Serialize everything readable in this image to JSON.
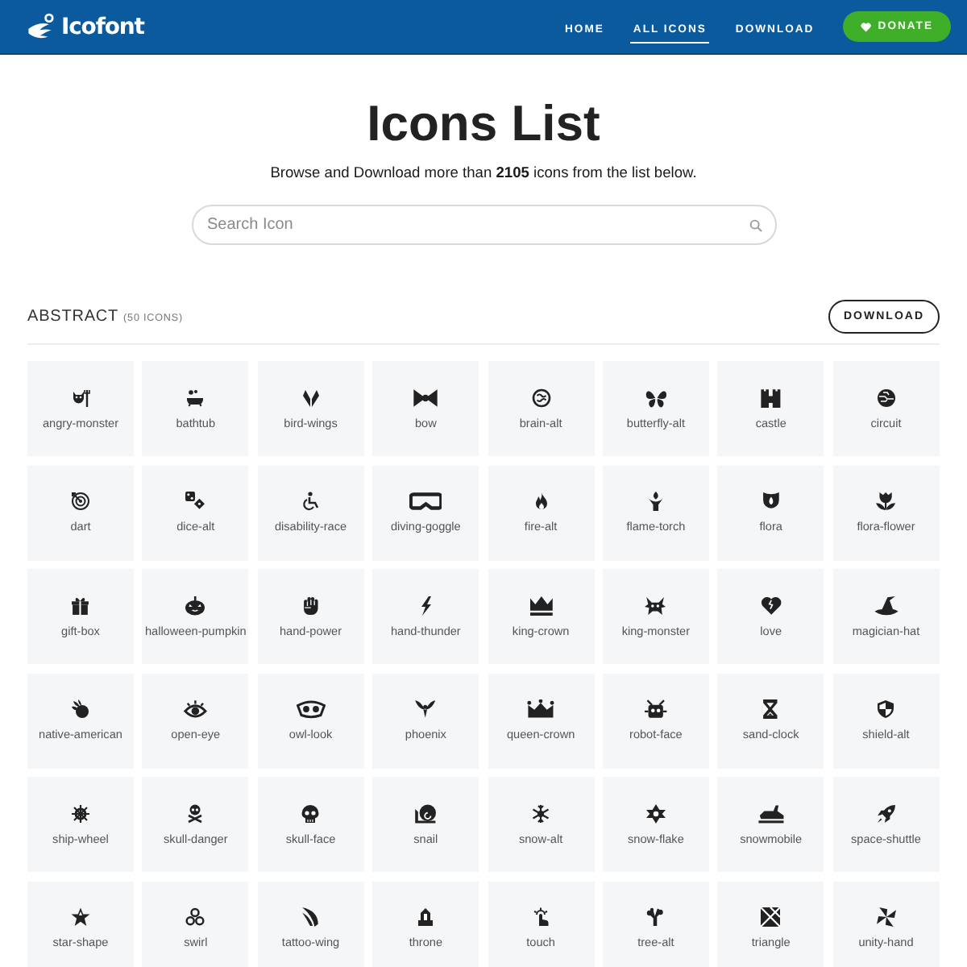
{
  "header": {
    "logo": {
      "text": "Icofont"
    },
    "nav": [
      {
        "label": "HOME",
        "selected": false
      },
      {
        "label": "ALL ICONS",
        "selected": true
      },
      {
        "label": "DOWNLOAD",
        "selected": false
      }
    ],
    "donate_button": {
      "label": "DONATE"
    }
  },
  "hero": {
    "title": "Icons List",
    "subtitle": "Browse and Download more than **2105** icons from the list below.",
    "search": {
      "placeholder": "Search Icon"
    }
  },
  "section": {
    "title": "ABSTRACT",
    "count": "(50 ICONS)",
    "download_button": {
      "label": "DOWNLOAD"
    },
    "icons": [
      {
        "label": "angry-monster"
      },
      {
        "label": "bathtub"
      },
      {
        "label": "bird-wings"
      },
      {
        "label": "bow"
      },
      {
        "label": "brain-alt"
      },
      {
        "label": "butterfly-alt"
      },
      {
        "label": "castle"
      },
      {
        "label": "circuit"
      },
      {
        "label": "dart"
      },
      {
        "label": "dice-alt"
      },
      {
        "label": "disability-race"
      },
      {
        "label": "diving-goggle"
      },
      {
        "label": "fire-alt"
      },
      {
        "label": "flame-torch"
      },
      {
        "label": "flora"
      },
      {
        "label": "flora-flower"
      },
      {
        "label": "gift-box"
      },
      {
        "label": "halloween-pumpkin"
      },
      {
        "label": "hand-power"
      },
      {
        "label": "hand-thunder"
      },
      {
        "label": "king-crown"
      },
      {
        "label": "king-monster"
      },
      {
        "label": "love"
      },
      {
        "label": "magician-hat"
      },
      {
        "label": "native-american"
      },
      {
        "label": "open-eye"
      },
      {
        "label": "owl-look"
      },
      {
        "label": "phoenix"
      },
      {
        "label": "queen-crown"
      },
      {
        "label": "robot-face"
      },
      {
        "label": "sand-clock"
      },
      {
        "label": "shield-alt"
      },
      {
        "label": "ship-wheel"
      },
      {
        "label": "skull-danger"
      },
      {
        "label": "skull-face"
      },
      {
        "label": "snail"
      },
      {
        "label": "snow-alt"
      },
      {
        "label": "snow-flake"
      },
      {
        "label": "snowmobile"
      },
      {
        "label": "space-shuttle"
      },
      {
        "label": "star-shape"
      },
      {
        "label": "swirl"
      },
      {
        "label": "tattoo-wing"
      },
      {
        "label": "throne"
      },
      {
        "label": "touch"
      },
      {
        "label": "tree-alt"
      },
      {
        "label": "triangle"
      },
      {
        "label": "unity-hand"
      }
    ]
  }
}
